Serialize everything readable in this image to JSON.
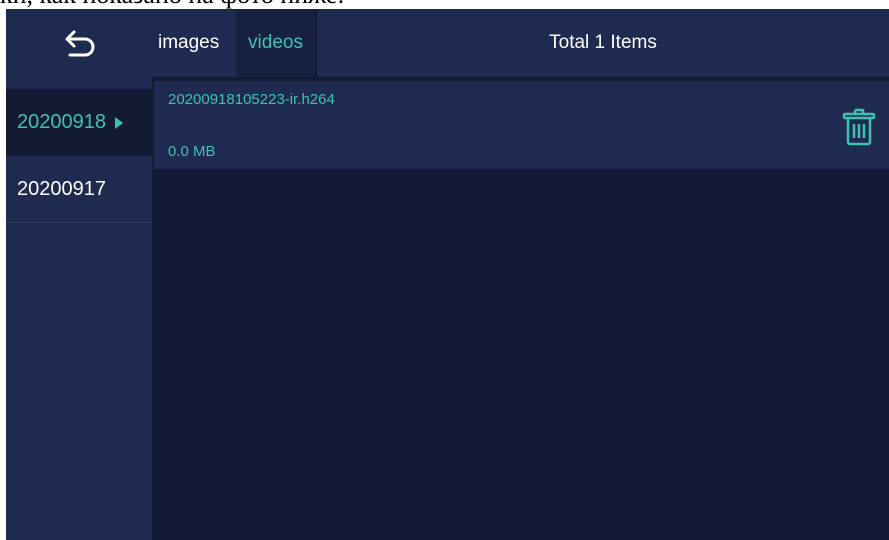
{
  "page_caption": "ки, как показано на фото ниже:",
  "sidebar": {
    "back_icon": "back-arrow-icon",
    "dates": [
      {
        "label": "20200918",
        "active": true
      },
      {
        "label": "20200917",
        "active": false
      }
    ]
  },
  "header": {
    "tabs": [
      {
        "label": "images",
        "active": false
      },
      {
        "label": "videos",
        "active": true
      }
    ],
    "total_label": "Total 1 Items"
  },
  "files": [
    {
      "name": "20200918105223-ir.h264",
      "size": "0.0 MB",
      "action_icon": "trash-icon"
    }
  ],
  "colors": {
    "accent": "#3fc1b1",
    "panel": "#1e2a4f",
    "background": "#141a35"
  }
}
